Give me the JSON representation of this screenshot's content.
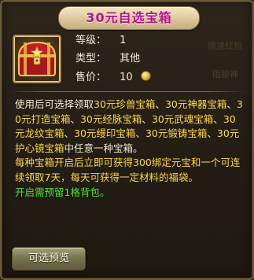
{
  "title": "30元自选宝箱",
  "item": {
    "icon": "treasure-chest-icon",
    "rows": [
      {
        "label": "等级：",
        "value": "1"
      },
      {
        "label": "类型：",
        "value": "其他"
      },
      {
        "label": "售价：",
        "value": "10"
      }
    ],
    "currency_icon": "coin-icon"
  },
  "background_hints": [
    "赠送红包",
    "阻聊神"
  ],
  "description": {
    "line1_pre": "使用后可选择领取",
    "boxes": [
      "30元珍兽宝箱",
      "30元神器宝箱",
      "30元打造宝箱",
      "30元经脉宝箱",
      "30元武魂宝箱",
      "30元龙纹宝箱",
      "30元缦印宝箱",
      "30元锻铸宝箱",
      "30元护心镜宝箱"
    ],
    "sep": "、",
    "line1_post": "中任意一种宝箱。",
    "para2_pre": "每种宝箱开启后立即可获得",
    "para2_hl": "300绑定元宝",
    "para2_mid": "和一个可连续领取",
    "para2_hl2": "7天",
    "para2_post": "，每天可获得一定材料的福袋。",
    "note": "开启需预留1格背包。"
  },
  "button": {
    "label": "可选预览"
  },
  "colors": {
    "title": "#b2138f",
    "highlight": "#ffd84a",
    "note": "#4ee23a"
  }
}
